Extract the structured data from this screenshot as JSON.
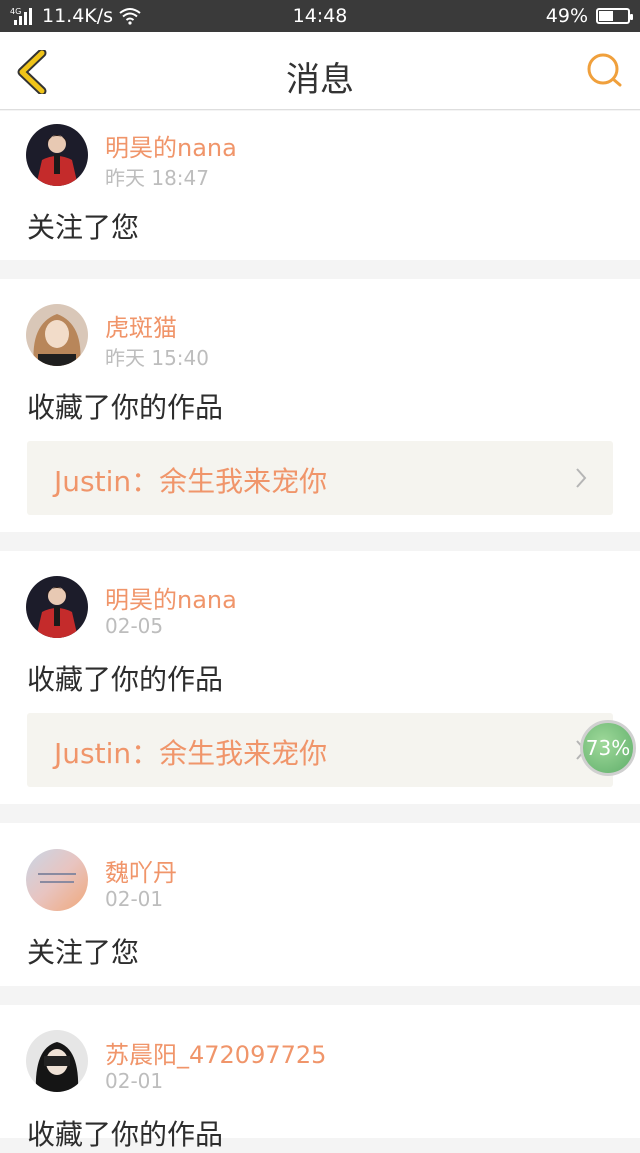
{
  "status_bar": {
    "network_label": "4G",
    "speed": "11.4K/s",
    "time": "14:48",
    "battery": "49%",
    "battery_level": 0.49
  },
  "header": {
    "title": "消息",
    "back_icon": "chevron-left-icon",
    "search_icon": "search-icon",
    "accent_color": "#f0a03c"
  },
  "messages": [
    {
      "username": "明昊的nana",
      "time": "昨天 18:47",
      "action": "关注了您"
    },
    {
      "username": "虎斑猫",
      "time": "昨天 15:40",
      "action": "收藏了你的作品",
      "work": "Justin：余生我来宠你"
    },
    {
      "username": "明昊的nana",
      "time": "02-05",
      "action": "收藏了你的作品",
      "work": "Justin：余生我来宠你"
    },
    {
      "username": "魏吖丹",
      "time": "02-01",
      "action": "关注了您"
    },
    {
      "username": "苏晨阳_472097725",
      "time": "02-01",
      "action": "收藏了你的作品"
    }
  ],
  "progress_bubble": {
    "label": "73%",
    "value": 0.73
  },
  "colors": {
    "username": "#f0956a",
    "timestamp": "#bdbdbd",
    "link_bg": "#f5f4ef"
  }
}
